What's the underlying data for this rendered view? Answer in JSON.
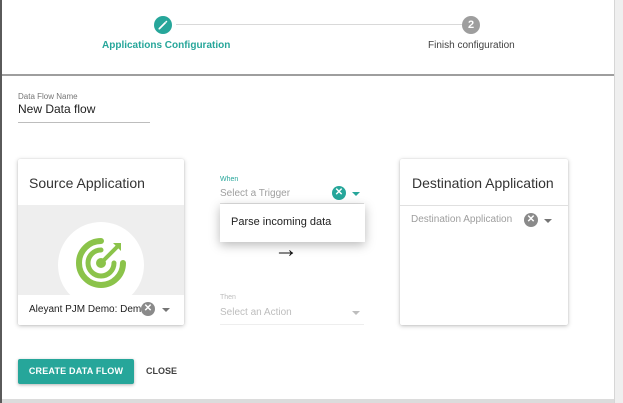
{
  "stepper": {
    "step1": {
      "icon": "pencil-icon",
      "label": "Applications Configuration",
      "state": "active"
    },
    "step2": {
      "number": "2",
      "label": "Finish configuration",
      "state": "inactive"
    }
  },
  "flow_name": {
    "label": "Data Flow Name",
    "value": "New Data flow"
  },
  "source": {
    "title": "Source Application",
    "logo": "target-logo-icon",
    "selected": "Aleyant PJM Demo: Dem"
  },
  "trigger": {
    "label": "When",
    "placeholder": "Select a Trigger",
    "options": [
      "Parse incoming data"
    ]
  },
  "action": {
    "label": "Then",
    "placeholder": "Select an Action"
  },
  "destination": {
    "title": "Destination Application",
    "placeholder": "Destination Application"
  },
  "buttons": {
    "create": "CREATE DATA FLOW",
    "close": "CLOSE"
  },
  "colors": {
    "accent": "#26a69a",
    "logo_green": "#8bc34a",
    "inactive": "#9e9e9e"
  }
}
